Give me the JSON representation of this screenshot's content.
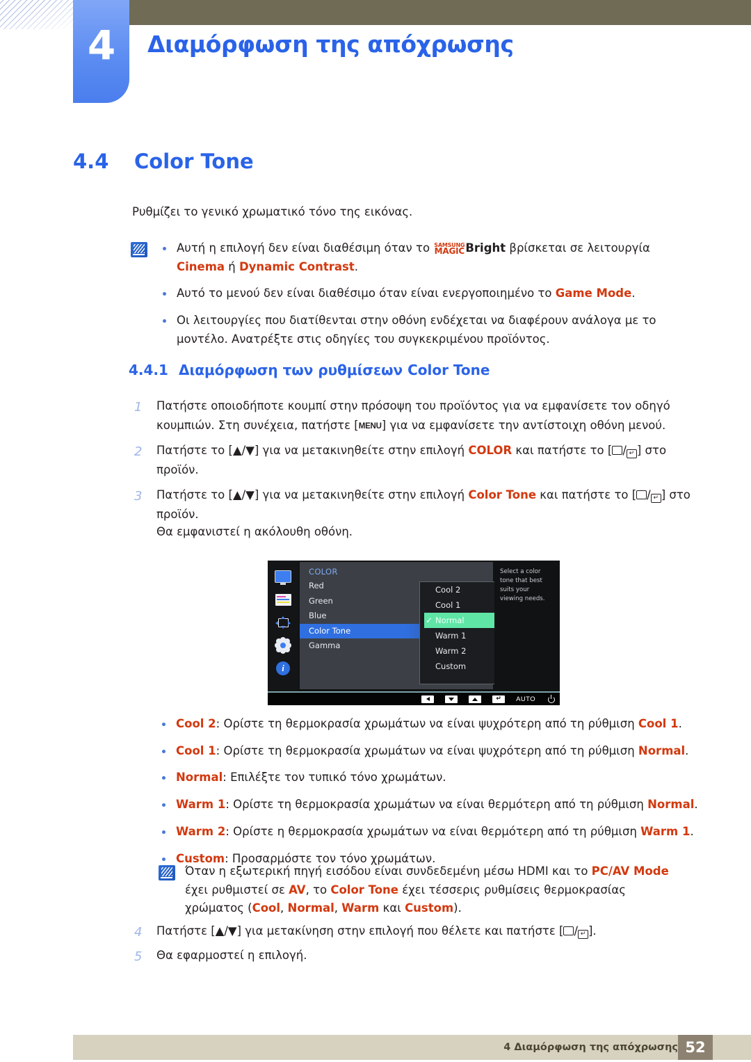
{
  "header": {
    "chapter_number": "4",
    "chapter_title": "Διαμόρφωση της απόχρωσης"
  },
  "section": {
    "number": "4.4",
    "title": "Color Tone",
    "intro": "Ρυθμίζει το γενικό χρωματικό τόνο της εικόνας."
  },
  "note_top": {
    "icon": "note-icon",
    "bullets": [
      {
        "pre": "Αυτή η επιλογή δεν είναι διαθέσιμη όταν το ",
        "magic_top": "SAMSUNG",
        "magic_bottom": "MAGIC",
        "bright": "Bright",
        "mid": " βρίσκεται σε λειτουργία ",
        "term1": "Cinema",
        "conj": " ή ",
        "term2": "Dynamic Contrast",
        "post": "."
      },
      {
        "pre": "Αυτό το μενού δεν είναι διαθέσιμο όταν είναι ενεργοποιημένο το ",
        "term1": "Game Mode",
        "post": "."
      },
      {
        "pre": "Οι λειτουργίες που διατίθενται στην οθόνη ενδέχεται να διαφέρουν ανάλογα με το μοντέλο. Ανατρέξτε στις οδηγίες του συγκεκριμένου προϊόντος.",
        "term1": "",
        "post": ""
      }
    ]
  },
  "subsection": {
    "number": "4.4.1",
    "title": "Διαμόρφωση των ρυθμίσεων Color Tone"
  },
  "steps_top": [
    {
      "n": "1",
      "part1": "Πατήστε οποιοδήποτε κουμπί στην πρόσοψη του προϊόντος για να εμφανίσετε τον οδηγό κουμπιών. Στη συνέχεια, πατήστε [",
      "key": "MENU",
      "part2": "] για να εμφανίσετε την αντίστοιχη οθόνη μενού."
    },
    {
      "n": "2",
      "part1": "Πατήστε το [▲/▼] για να μετακινηθείτε στην επιλογή ",
      "term": "COLOR",
      "part2": " και πατήστε το [",
      "part3": "] στο προϊόν."
    },
    {
      "n": "3",
      "part1": "Πατήστε το [▲/▼] για να μετακινηθείτε στην επιλογή ",
      "term": "Color Tone",
      "part2": " και πατήστε το [",
      "part3": "] στο προϊόν."
    }
  ],
  "after_step3": "Θα εμφανιστεί η ακόλουθη οθόνη.",
  "osd": {
    "category": "COLOR",
    "sidebar_icons": [
      "monitor-icon",
      "picture-color-icon",
      "size-position-icon",
      "setup-gear-icon",
      "information-icon"
    ],
    "menu_items": [
      {
        "label": "Red",
        "selected": false
      },
      {
        "label": "Green",
        "selected": false
      },
      {
        "label": "Blue",
        "selected": false
      },
      {
        "label": "Color Tone",
        "selected": true
      },
      {
        "label": "Gamma",
        "selected": false
      }
    ],
    "options": [
      {
        "label": "Cool 2",
        "checked": false
      },
      {
        "label": "Cool 1",
        "checked": false
      },
      {
        "label": "Normal",
        "checked": true
      },
      {
        "label": "Warm 1",
        "checked": false
      },
      {
        "label": "Warm 2",
        "checked": false
      },
      {
        "label": "Custom",
        "checked": false
      }
    ],
    "help_text": "Select a color tone that best suits your viewing needs.",
    "bottom_buttons": [
      "back-arrow-button",
      "down-arrow-button",
      "up-arrow-button",
      "enter-button",
      "auto-button",
      "power-button"
    ],
    "auto_label": "AUTO",
    "highlight_color": "#5fe6a6",
    "selected_color": "#2f6fe0"
  },
  "option_descriptions": [
    {
      "term": "Cool 2",
      "text": ": Ορίστε τη θερμοκρασία χρωμάτων να είναι ψυχρότερη από τη ρύθμιση ",
      "term2": "Cool 1",
      "end": "."
    },
    {
      "term": "Cool 1",
      "text": ": Ορίστε τη θερμοκρασία χρωμάτων να είναι ψυχρότερη από τη ρύθμιση ",
      "term2": "Normal",
      "end": "."
    },
    {
      "term": "Normal",
      "text": ": Επιλέξτε τον τυπικό τόνο χρωμάτων.",
      "term2": "",
      "end": ""
    },
    {
      "term": "Warm 1",
      "text": ": Ορίστε τη θερμοκρασία χρωμάτων να είναι θερμότερη από τη ρύθμιση ",
      "term2": "Normal",
      "end": "."
    },
    {
      "term": "Warm 2",
      "text": ": Ορίστε η θερμοκρασία χρωμάτων να είναι θερμότερη από τη ρύθμιση ",
      "term2": "Warm 1",
      "end": "."
    },
    {
      "term": "Custom",
      "text": ": Προσαρμόστε τον τόνο χρωμάτων.",
      "term2": "",
      "end": ""
    }
  ],
  "note_bottom": {
    "icon": "note-icon",
    "p1": "Όταν η εξωτερική πηγή εισόδου είναι συνδεδεμένη μέσω HDMI και το ",
    "t1": "PC/AV Mode",
    "p2": " έχει ρυθμιστεί σε ",
    "t2": "AV",
    "p3": ", το ",
    "t3": "Color Tone",
    "p4": " έχει τέσσερις ρυθμίσεις θερμοκρασίας χρώματος (",
    "t4": "Cool",
    "p5": ", ",
    "t5": "Normal",
    "p6": ", ",
    "t6": "Warm",
    "p7": " και ",
    "t7": "Custom",
    "p8": ")."
  },
  "steps_bottom": [
    {
      "n": "4",
      "part1": "Πατήστε [▲/▼] για μετακίνηση στην επιλογή που θέλετε και πατήστε [",
      "part2": "]."
    },
    {
      "n": "5",
      "part1": "Θα εφαρμοστεί η επιλογή.",
      "part2": ""
    }
  ],
  "footer": {
    "text": "4 Διαμόρφωση της απόχρωσης",
    "page": "52"
  }
}
